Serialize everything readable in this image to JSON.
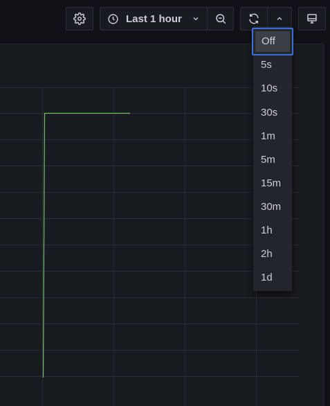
{
  "toolbar": {
    "time_range_label": "Last 1 hour",
    "icons": {
      "settings": "gear-icon",
      "clock": "clock-icon",
      "time_dropdown": "chevron-down-icon",
      "zoom_out": "zoom-out-icon",
      "refresh": "refresh-icon",
      "refresh_interval_toggle": "chevron-up-icon",
      "tv_mode": "monitor-icon"
    }
  },
  "refresh_menu": {
    "selected": "Off",
    "items": [
      "Off",
      "5s",
      "10s",
      "30s",
      "1m",
      "5m",
      "15m",
      "30m",
      "1h",
      "2h",
      "1d"
    ]
  },
  "colors": {
    "background": "#111217",
    "panel": "#181b1f",
    "series_line": "#73bf69",
    "focus_border": "#3d71d9"
  }
}
